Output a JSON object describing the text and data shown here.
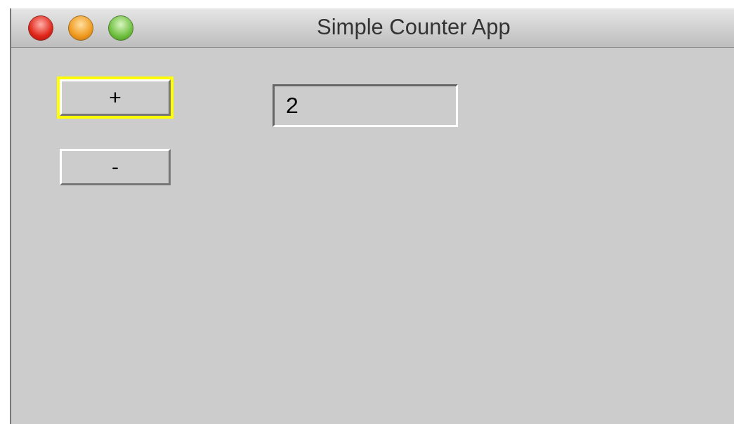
{
  "window": {
    "title": "Simple Counter App"
  },
  "buttons": [
    {
      "label": "+",
      "focused": true
    },
    {
      "label": "-",
      "focused": false
    }
  ],
  "counter_field": {
    "value": "2"
  }
}
